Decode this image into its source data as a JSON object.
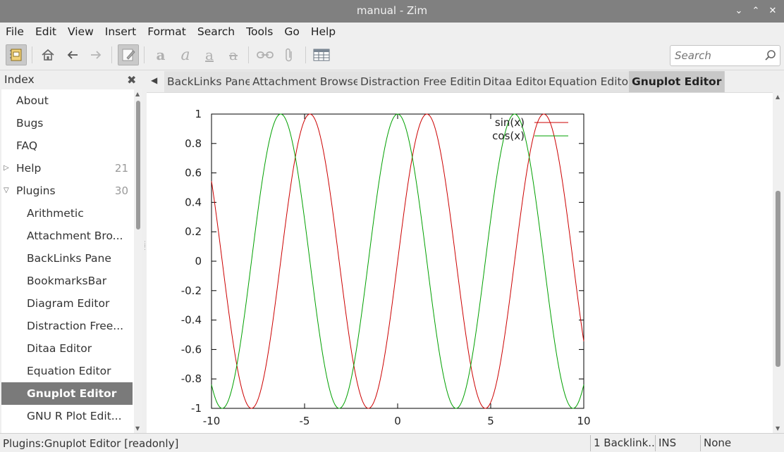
{
  "window": {
    "title": "manual - Zim"
  },
  "menu": [
    "File",
    "Edit",
    "View",
    "Insert",
    "Format",
    "Search",
    "Tools",
    "Go",
    "Help"
  ],
  "toolbar": {
    "buttons": [
      "notebook-icon",
      "home-icon",
      "back-arrow-icon",
      "forward-arrow-icon",
      "edit-pencil-icon",
      "strong-icon",
      "emphasis-icon",
      "underline-icon",
      "strike-icon",
      "link-icon",
      "attach-icon",
      "table-icon"
    ]
  },
  "search": {
    "placeholder": "Search"
  },
  "index": {
    "title": "Index",
    "items": [
      {
        "label": "About",
        "count": ""
      },
      {
        "label": "Bugs",
        "count": ""
      },
      {
        "label": "FAQ",
        "count": ""
      },
      {
        "label": "Help",
        "count": "21",
        "expander": "right"
      },
      {
        "label": "Plugins",
        "count": "30",
        "expander": "down"
      },
      {
        "label": "Arithmetic",
        "count": ""
      },
      {
        "label": "Attachment Bro...",
        "count": ""
      },
      {
        "label": "BackLinks Pane",
        "count": ""
      },
      {
        "label": "BookmarksBar",
        "count": ""
      },
      {
        "label": "Diagram Editor",
        "count": ""
      },
      {
        "label": "Distraction Free...",
        "count": ""
      },
      {
        "label": "Ditaa Editor",
        "count": ""
      },
      {
        "label": "Equation Editor",
        "count": ""
      },
      {
        "label": "Gnuplot Editor",
        "count": "",
        "selected": true
      },
      {
        "label": "GNU R Plot Edit...",
        "count": ""
      }
    ]
  },
  "tabs": [
    "BackLinks Pane",
    "Attachment Browser",
    "Distraction Free Editing",
    "Ditaa Editor",
    "Equation Editor",
    "Gnuplot Editor"
  ],
  "chart_data": {
    "type": "line",
    "x_range": [
      -10,
      10
    ],
    "ylim": [
      -1,
      1
    ],
    "x_ticks": [
      "-10",
      "-5",
      "0",
      "5",
      "10"
    ],
    "y_ticks": [
      "-1",
      "-0.8",
      "-0.6",
      "-0.4",
      "-0.2",
      "0",
      "0.2",
      "0.4",
      "0.6",
      "0.8",
      "1"
    ],
    "series": [
      {
        "name": "sin(x)",
        "function": "sin",
        "color": "#cc0000"
      },
      {
        "name": "cos(x)",
        "function": "cos",
        "color": "#00a000"
      }
    ],
    "legend": "top-right",
    "grid": false
  },
  "status": {
    "page": "Plugins:Gnuplot Editor [readonly]",
    "backlinks": "1 Backlink...",
    "mode": "INS",
    "style": "None"
  }
}
